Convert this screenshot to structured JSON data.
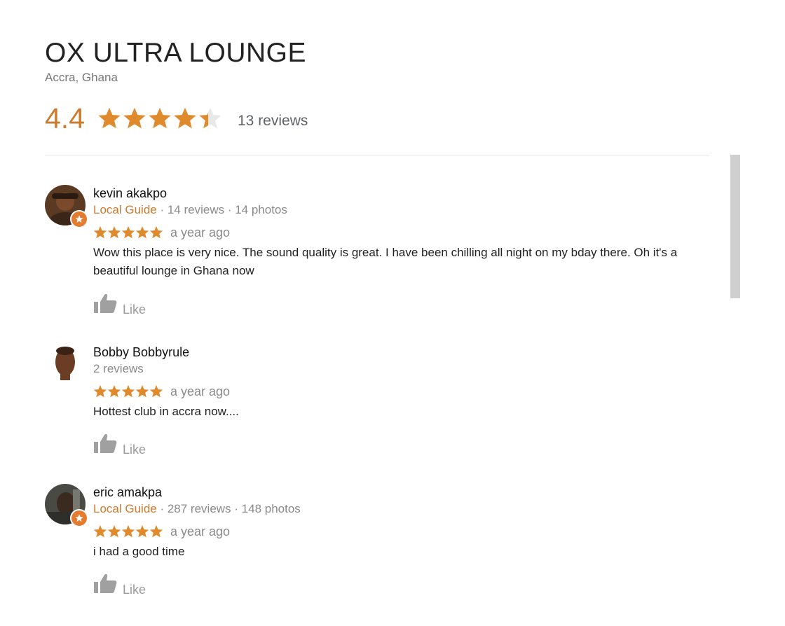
{
  "place": {
    "title": "OX ULTRA LOUNGE",
    "location": "Accra, Ghana",
    "rating": "4.4",
    "rating_value": 4.4,
    "reviews_count": "13 reviews"
  },
  "colors": {
    "star": "#e08a2e",
    "accent": "#cc7a2e"
  },
  "reviews": [
    {
      "name": "kevin akakpo",
      "guide_label": "Local Guide",
      "stats": " · 14 reviews · 14 photos",
      "stars": 5,
      "date": "a year ago",
      "text": "Wow this place is very nice. The sound quality is great. I have been chilling all night on my bday there. Oh it's a beautiful lounge in Ghana now",
      "like_label": "Like"
    },
    {
      "name": "Bobby Bobbyrule",
      "stats": "2 reviews",
      "stars": 5,
      "date": "a year ago",
      "text": "Hottest club in accra now....",
      "like_label": "Like"
    },
    {
      "name": "eric amakpa",
      "guide_label": "Local Guide",
      "stats": " · 287 reviews · 148 photos",
      "stars": 5,
      "date": "a year ago",
      "text": "i had a good time",
      "like_label": "Like"
    }
  ]
}
